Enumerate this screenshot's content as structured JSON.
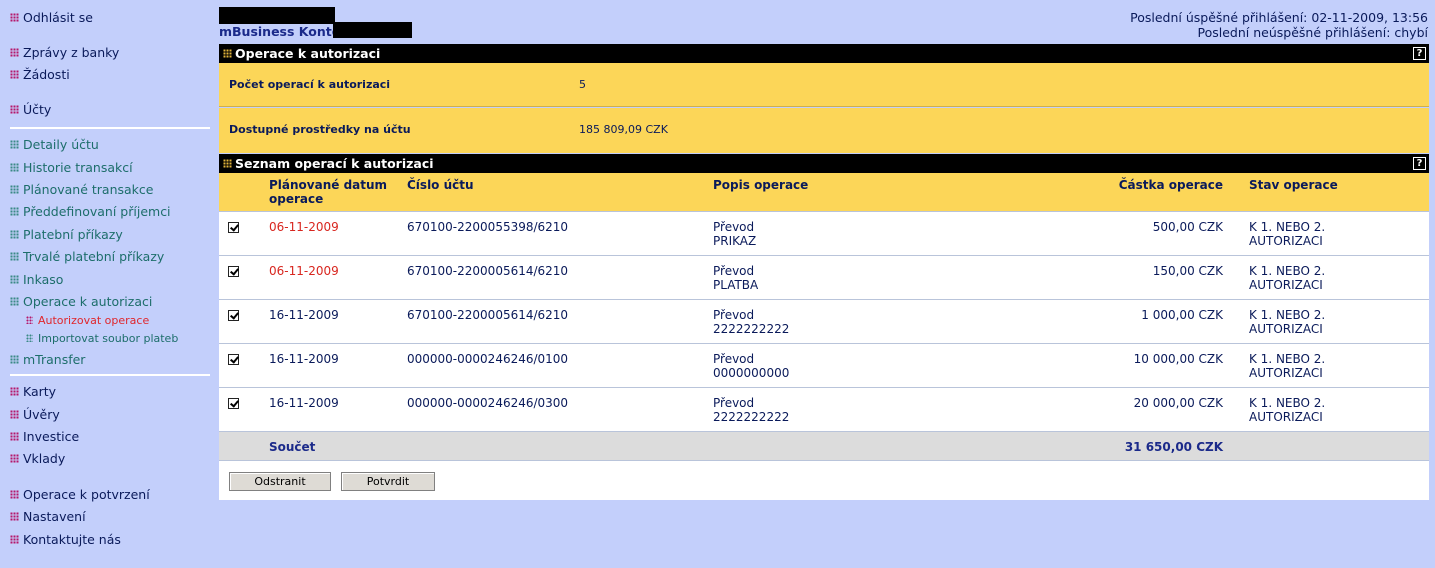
{
  "sidebar": {
    "logout": "Odhlásit se",
    "bank_messages": "Zprávy z banky",
    "requests": "Žádosti",
    "accounts": "Účty",
    "account_items": [
      "Detaily účtu",
      "Historie transakcí",
      "Plánované transakce",
      "Předdefinovaní příjemci",
      "Platební příkazy",
      "Trvalé platební příkazy",
      "Inkaso",
      "Operace k autorizaci"
    ],
    "sub_items": [
      "Autorizovat operace",
      "Importovat soubor plateb"
    ],
    "mtransfer": "mTransfer",
    "products": [
      "Karty",
      "Úvěry",
      "Investice",
      "Vklady"
    ],
    "bottom": [
      "Operace k potvrzení",
      "Nastavení",
      "Kontaktujte nás"
    ]
  },
  "header": {
    "product_name": "mBusiness Konto",
    "last_success_login": "Poslední úspěšné přihlášení: 02-11-2009, 13:56",
    "last_failed_login": "Poslední neúspěšné přihlášení: chybí"
  },
  "summary": {
    "title": "Operace k autorizaci",
    "count_label": "Počet operací k autorizaci",
    "count_value": "5",
    "funds_label": "Dostupné prostředky na účtu",
    "funds_value": "185 809,09 CZK"
  },
  "list": {
    "title": "Seznam operací k autorizaci",
    "help": "?",
    "columns": {
      "date_line1": "Plánované datum",
      "date_line2": "operace",
      "account": "Číslo účtu",
      "description": "Popis operace",
      "amount": "Částka operace",
      "status": "Stav operace"
    },
    "rows": [
      {
        "date": "06-11-2009",
        "account": "670100-2200055398/6210",
        "desc1": "Převod",
        "desc2": "PRIKAZ",
        "amount": "500,00 CZK",
        "status1": "K 1. NEBO 2.",
        "status2": "AUTORIZACI",
        "checked": true
      },
      {
        "date": "06-11-2009",
        "account": "670100-2200005614/6210",
        "desc1": "Převod",
        "desc2": "PLATBA",
        "amount": "150,00 CZK",
        "status1": "K 1. NEBO 2.",
        "status2": "AUTORIZACI",
        "checked": true
      },
      {
        "date": "16-11-2009",
        "account": "670100-2200005614/6210",
        "desc1": "Převod",
        "desc2": "2222222222",
        "amount": "1 000,00 CZK",
        "status1": "K 1. NEBO 2.",
        "status2": "AUTORIZACI",
        "checked": true
      },
      {
        "date": "16-11-2009",
        "account": "000000-0000246246/0100",
        "desc1": "Převod",
        "desc2": "0000000000",
        "amount": "10 000,00 CZK",
        "status1": "K 1. NEBO 2.",
        "status2": "AUTORIZACI",
        "checked": true
      },
      {
        "date": "16-11-2009",
        "account": "000000-0000246246/0300",
        "desc1": "Převod",
        "desc2": "2222222222",
        "amount": "20 000,00 CZK",
        "status1": "K 1. NEBO 2.",
        "status2": "AUTORIZACI",
        "checked": true
      }
    ],
    "total_label": "Součet",
    "total_value": "31 650,00 CZK",
    "btn_remove": "Odstranit",
    "btn_confirm": "Potvrdit"
  },
  "colors": {
    "background": "#c3cffb",
    "header_bar": "#000000",
    "summary_bg": "#fcd658",
    "overdue_date": "#d8261f"
  }
}
